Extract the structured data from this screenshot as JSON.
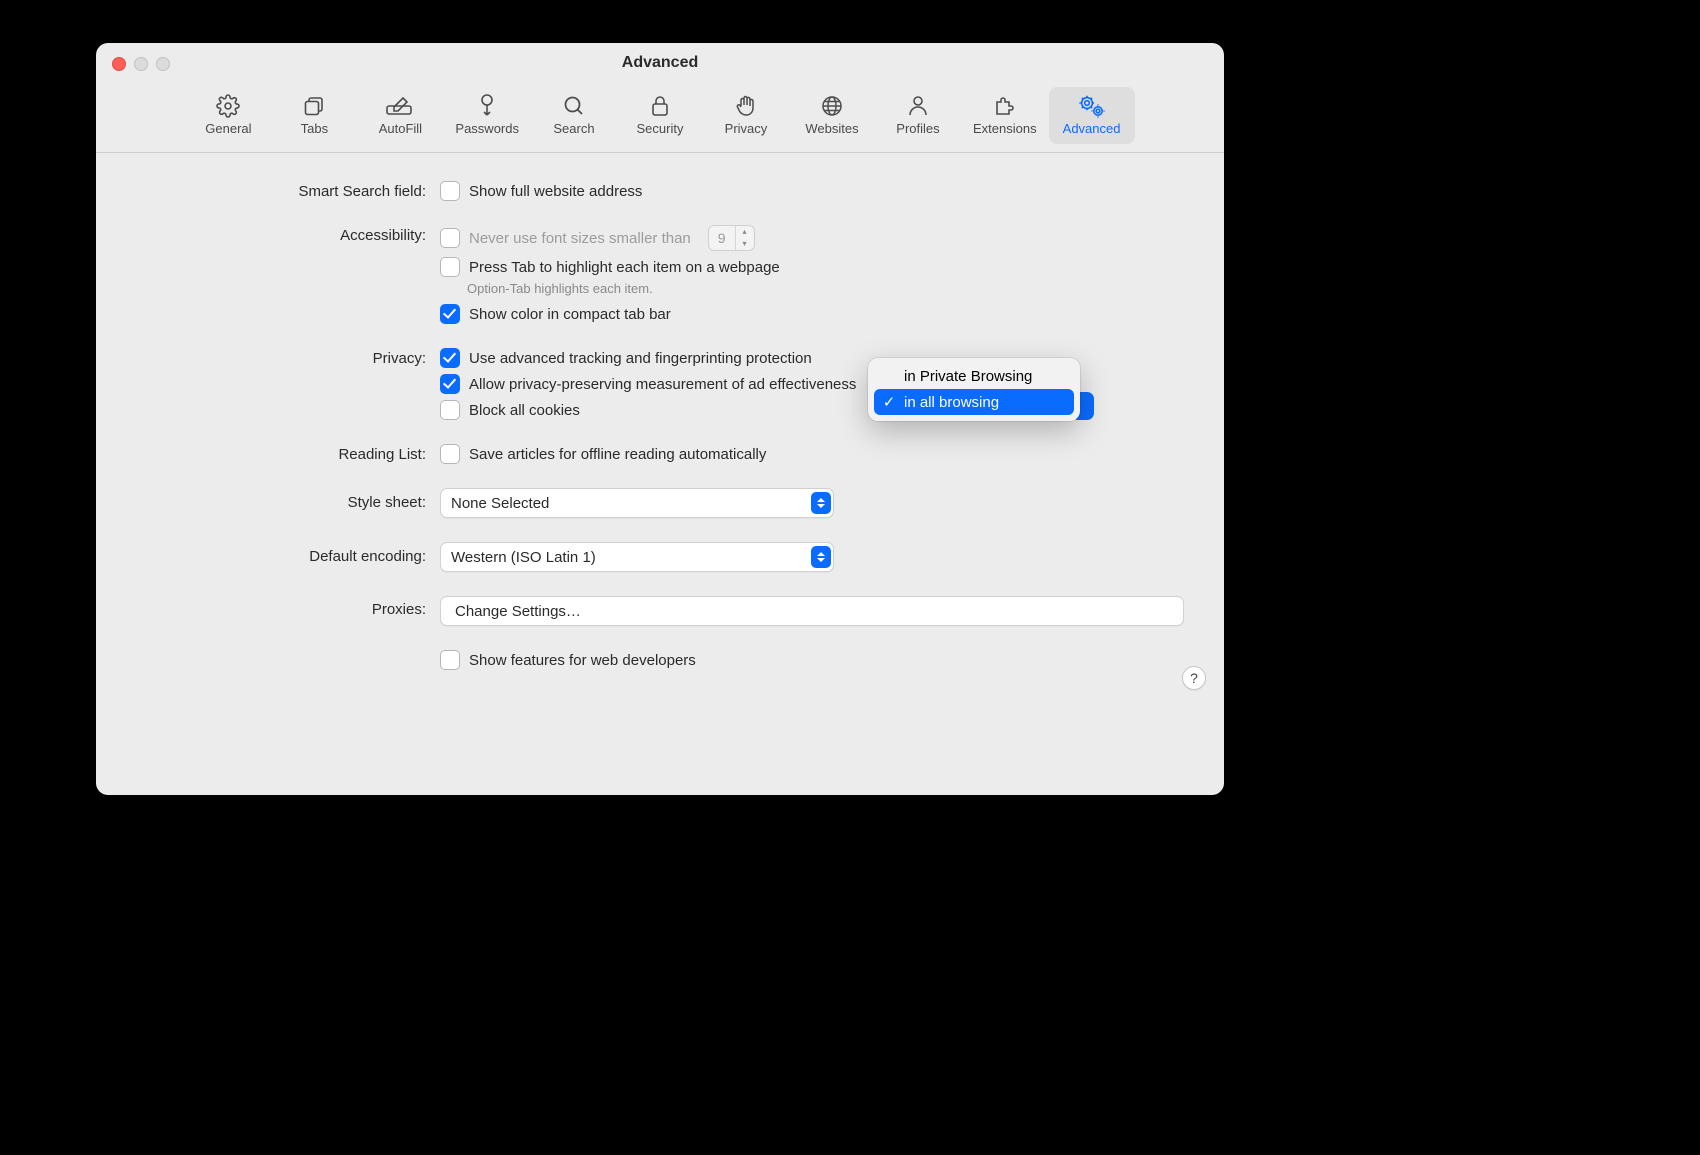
{
  "window": {
    "title": "Advanced"
  },
  "toolbar": {
    "general": "General",
    "tabs": "Tabs",
    "autofill": "AutoFill",
    "passwords": "Passwords",
    "search": "Search",
    "security": "Security",
    "privacy": "Privacy",
    "websites": "Websites",
    "profiles": "Profiles",
    "extensions": "Extensions",
    "advanced": "Advanced"
  },
  "sections": {
    "smart_search": {
      "label": "Smart Search field:",
      "show_full_url": "Show full website address"
    },
    "accessibility": {
      "label": "Accessibility:",
      "min_font": "Never use font sizes smaller than",
      "min_font_value": "9",
      "press_tab": "Press Tab to highlight each item on a webpage",
      "option_tab_hint": "Option-Tab highlights each item.",
      "show_color": "Show color in compact tab bar"
    },
    "privacy": {
      "label": "Privacy:",
      "advanced_tracking": "Use advanced tracking and fingerprinting protection",
      "ad_measurement": "Allow privacy-preserving measurement of ad effectiveness",
      "block_cookies": "Block all cookies"
    },
    "reading_list": {
      "label": "Reading List:",
      "save_offline": "Save articles for offline reading automatically"
    },
    "style_sheet": {
      "label": "Style sheet:",
      "value": "None Selected"
    },
    "default_encoding": {
      "label": "Default encoding:",
      "value": "Western (ISO Latin 1)"
    },
    "proxies": {
      "label": "Proxies:",
      "button": "Change Settings…"
    },
    "dev": {
      "show_dev": "Show features for web developers"
    }
  },
  "popup": {
    "options": [
      "in Private Browsing",
      "in all browsing"
    ],
    "selected_index": 1
  },
  "help": {
    "icon": "?"
  }
}
